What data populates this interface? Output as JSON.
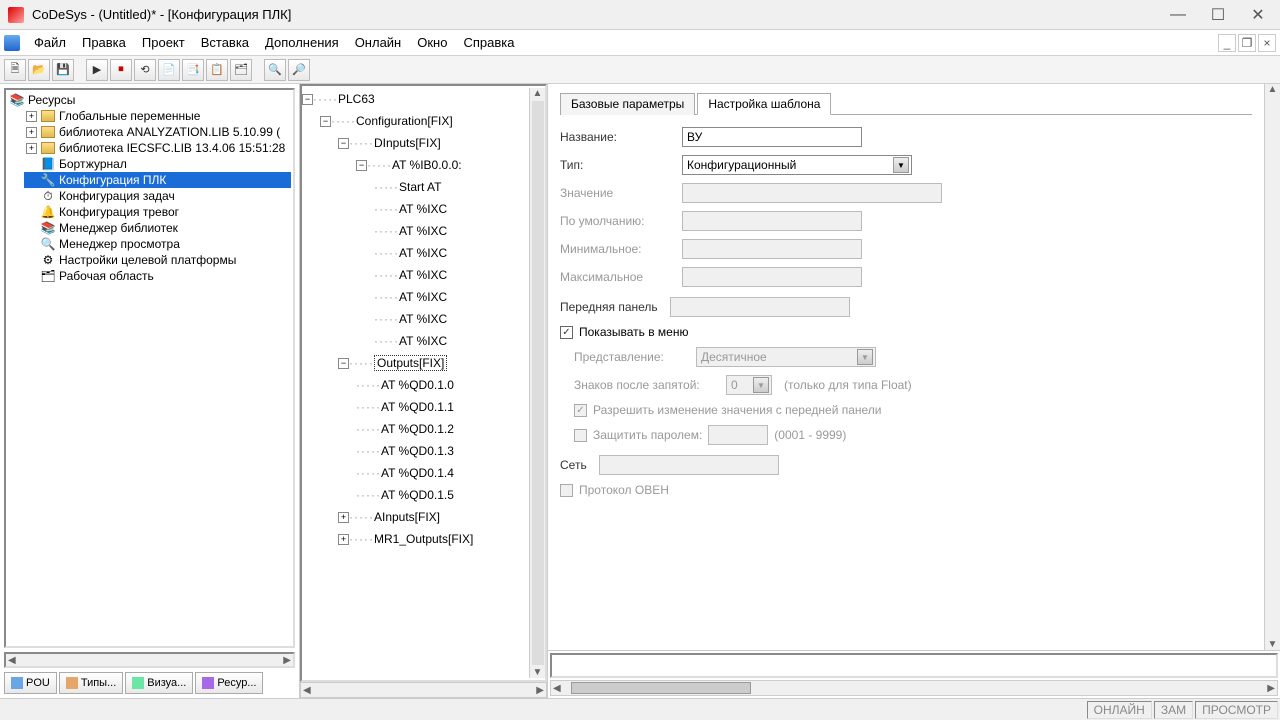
{
  "window": {
    "title": "CoDeSys - (Untitled)* - [Конфигурация ПЛК]"
  },
  "menu": {
    "file": "Файл",
    "edit": "Правка",
    "project": "Проект",
    "insert": "Вставка",
    "extras": "Дополнения",
    "online": "Онлайн",
    "window": "Окно",
    "help": "Справка"
  },
  "left_tree": {
    "root": "Ресурсы",
    "items": [
      {
        "label": "Глобальные переменные",
        "icon": "folder",
        "expand": "+"
      },
      {
        "label": "библиотека ANALYZATION.LIB 5.10.99 (",
        "icon": "folder",
        "expand": "+"
      },
      {
        "label": "библиотека IECSFC.LIB 13.4.06 15:51:28",
        "icon": "folder",
        "expand": "+"
      },
      {
        "label": "Бортжурнал",
        "icon": "log"
      },
      {
        "label": "Конфигурация ПЛК",
        "icon": "plc",
        "selected": true
      },
      {
        "label": "Конфигурация задач",
        "icon": "task"
      },
      {
        "label": "Конфигурация тревог",
        "icon": "alarm"
      },
      {
        "label": "Менеджер библиотек",
        "icon": "lib"
      },
      {
        "label": "Менеджер просмотра",
        "icon": "watch"
      },
      {
        "label": "Настройки целевой платформы",
        "icon": "target"
      },
      {
        "label": "Рабочая область",
        "icon": "work"
      }
    ]
  },
  "bottom_tabs": {
    "pou": "POU",
    "types": "Типы...",
    "visu": "Визуа...",
    "resources": "Ресур..."
  },
  "center_tree": {
    "root": "PLC63",
    "config": "Configuration[FIX]",
    "dinputs": "DInputs[FIX]",
    "at_ib": "AT %IB0.0.0:",
    "start_at": "Start AT",
    "ixc": [
      "AT %IXC",
      "AT %IXC",
      "AT %IXC",
      "AT %IXC",
      "AT %IXC",
      "AT %IXC",
      "AT %IXC"
    ],
    "outputs": "Outputs[FIX]",
    "qd": [
      "AT %QD0.1.0",
      "AT %QD0.1.1",
      "AT %QD0.1.2",
      "AT %QD0.1.3",
      "AT %QD0.1.4",
      "AT %QD0.1.5"
    ],
    "ainputs": "AInputs[FIX]",
    "mr1": "MR1_Outputs[FIX]"
  },
  "tabs": {
    "base": "Базовые параметры",
    "template": "Настройка шаблона"
  },
  "form": {
    "name_label": "Название:",
    "name_value": "ВУ",
    "type_label": "Тип:",
    "type_value": "Конфигурационный",
    "value_label": "Значение",
    "default_label": "По умолчанию:",
    "min_label": "Минимальное:",
    "max_label": "Максимальное",
    "front_panel_label": "Передняя панель",
    "show_menu": "Показывать в меню",
    "repr_label": "Представление:",
    "repr_value": "Десятичное",
    "decimals_label": "Знаков после запятой:",
    "decimals_value": "0",
    "decimals_hint": "(только для типа Float)",
    "allow_change": "Разрешить изменение значения с передней панели",
    "protect_pwd": "Защитить паролем:",
    "pwd_hint": "(0001 - 9999)",
    "network_label": "Сеть",
    "proto_owen": "Протокол ОВЕН"
  },
  "status": {
    "online": "ОНЛАЙН",
    "zam": "ЗАМ",
    "view": "ПРОСМОТР"
  }
}
